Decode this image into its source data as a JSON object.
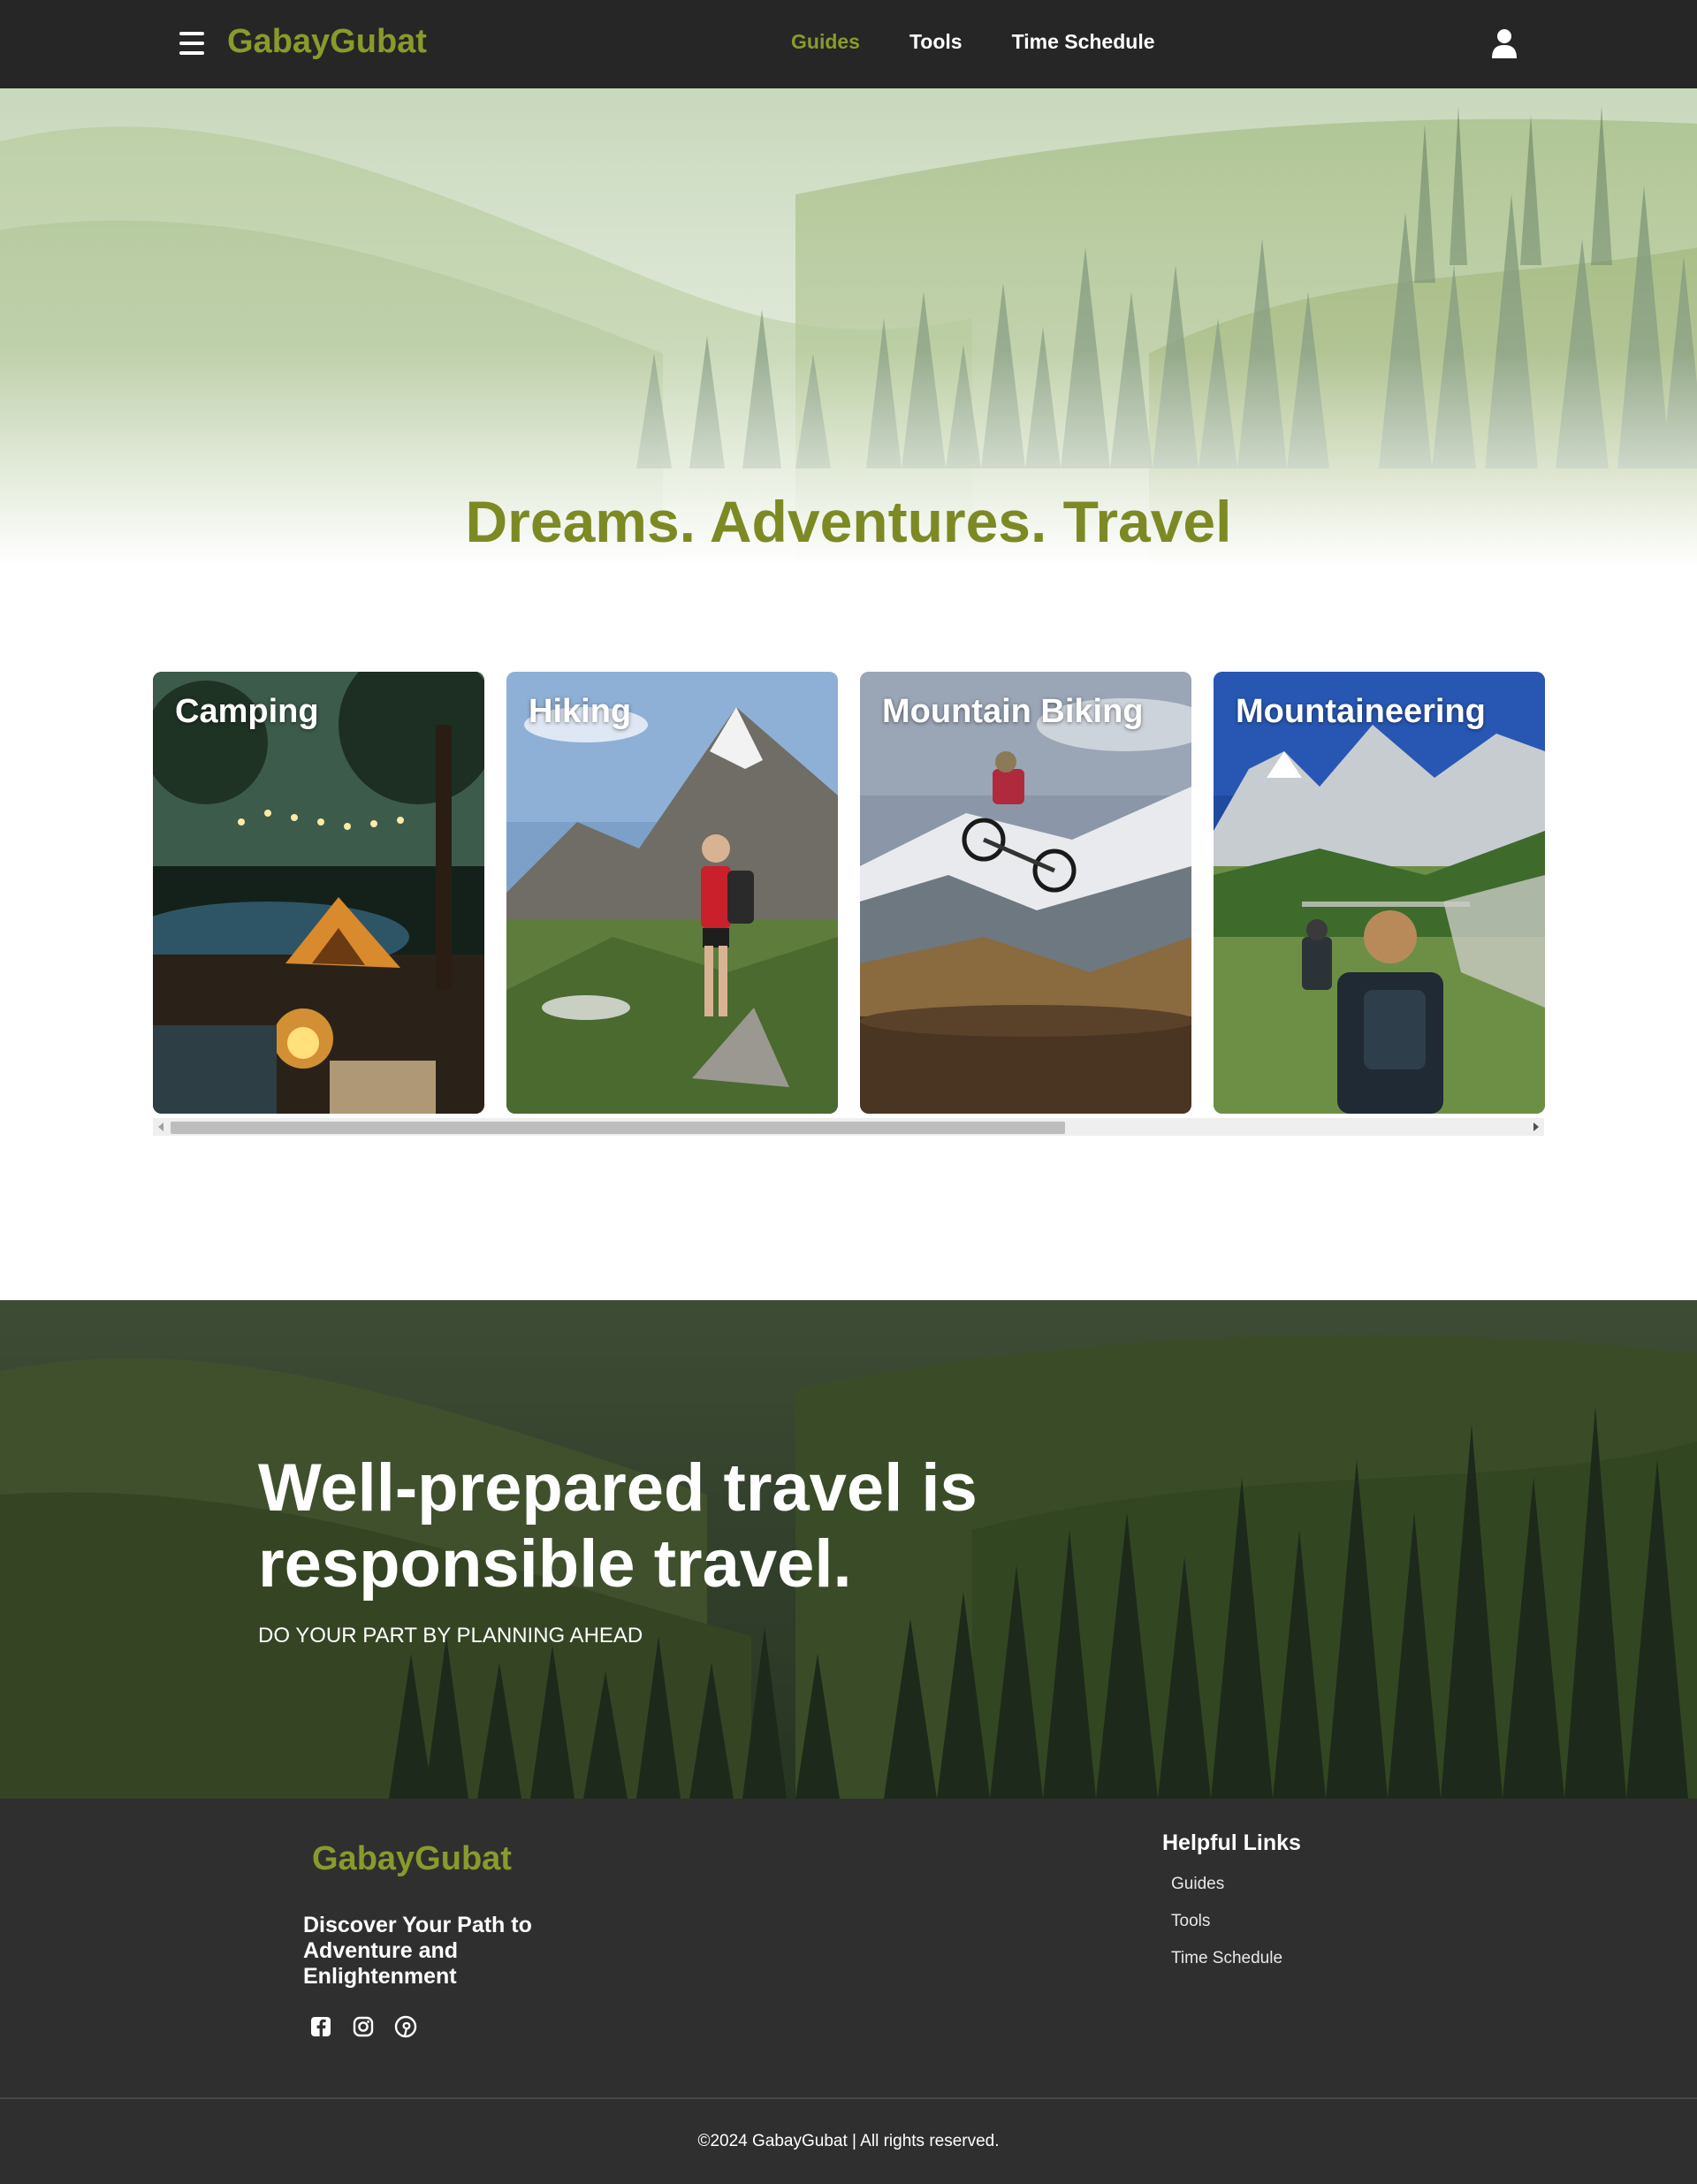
{
  "navbar": {
    "menu_icon": "hamburger-menu-icon",
    "brand": "GabayGubat",
    "links": [
      "Guides",
      "Tools",
      "Time Schedule"
    ],
    "active_link": "Guides",
    "user_icon": "user-icon"
  },
  "hero": {
    "title": "Dreams. Adventures. Travel"
  },
  "cards": [
    {
      "title": "Camping"
    },
    {
      "title": "Hiking"
    },
    {
      "title": "Mountain Biking"
    },
    {
      "title": "Mountaineering"
    }
  ],
  "scroll": {
    "thumb_fraction": 0.66
  },
  "banner": {
    "heading": "Well-prepared travel is responsible travel.",
    "subheading": "DO YOUR PART BY PLANNING AHEAD"
  },
  "footer": {
    "brand": "GabayGubat",
    "tagline": "Discover Your Path to Adventure and Enlightenment",
    "social_icons": [
      "facebook-icon",
      "instagram-icon",
      "pinterest-icon"
    ],
    "links_title": "Helpful Links",
    "links": [
      "Guides",
      "Tools",
      "Time Schedule"
    ],
    "copyright": "©2024 GabayGubat | All rights reserved."
  },
  "colors": {
    "brand": "#8a9a2b",
    "nav_bg": "#262626",
    "footer_bg": "#2f2f2f"
  }
}
